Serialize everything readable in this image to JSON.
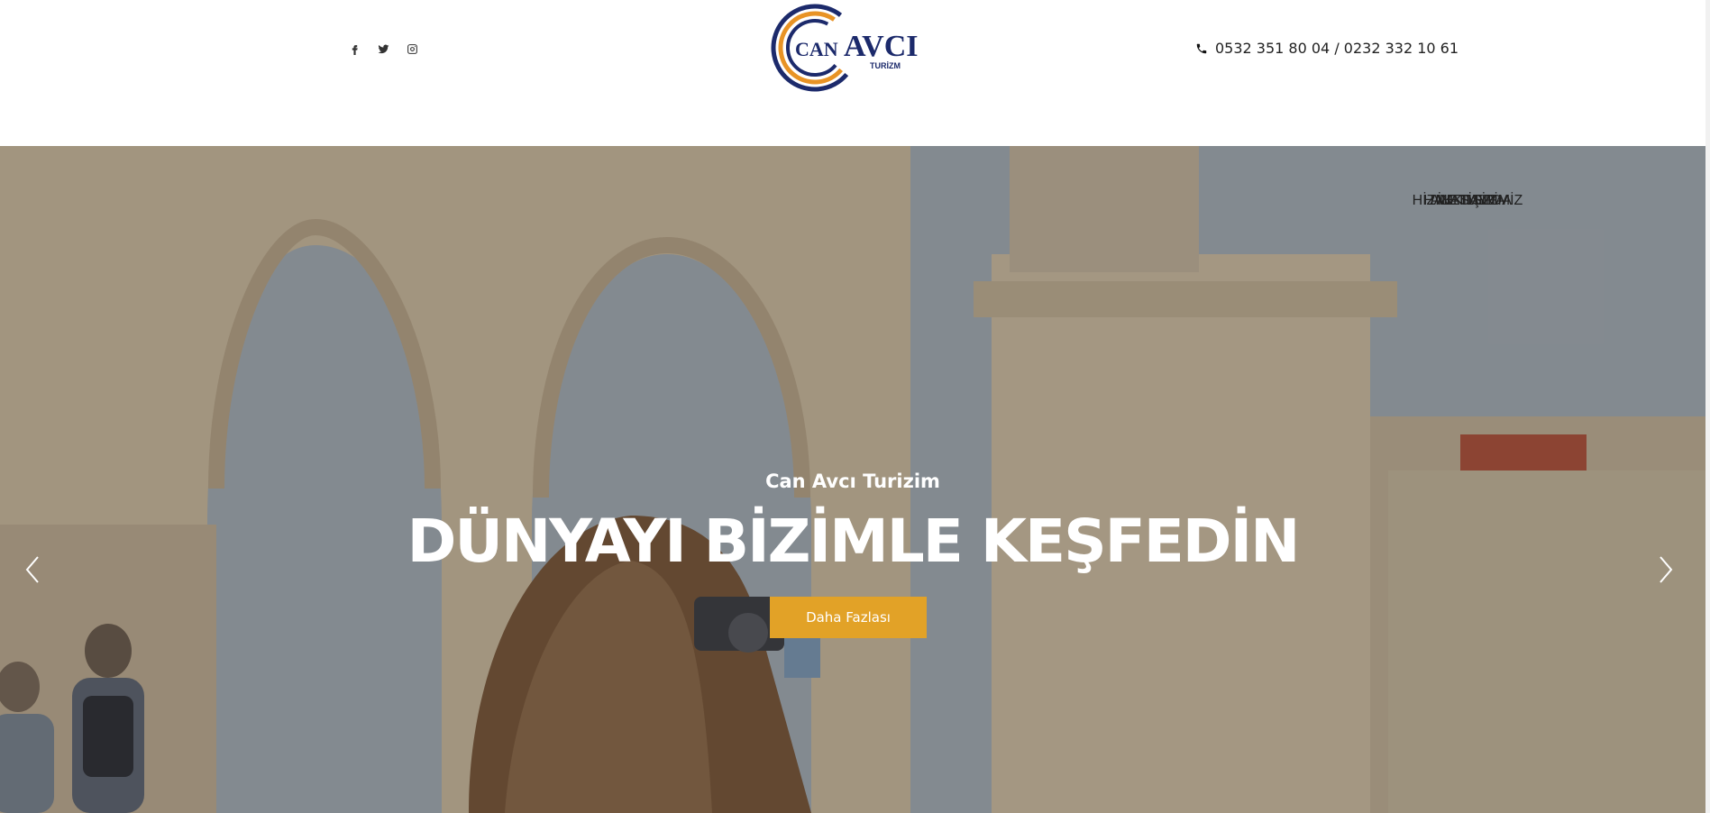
{
  "header": {
    "social": [
      {
        "name": "facebook-icon"
      },
      {
        "name": "twitter-icon"
      },
      {
        "name": "instagram-icon"
      }
    ],
    "logo": {
      "text_can": "CAN",
      "text_avci": "AVCI",
      "text_turizm": "TURİZM",
      "colors": {
        "navy": "#1c2a6b",
        "orange": "#e89325"
      }
    },
    "phone": "0532 351 80 04 / 0232 332 10 61"
  },
  "nav": {
    "items": [
      {
        "label": "ANASAYFA",
        "active": true
      },
      {
        "label": "HİZMETLERİMİZ",
        "active": false
      },
      {
        "label": "HAKKIMIZDA",
        "active": false
      },
      {
        "label": "İLETİŞİM",
        "active": false
      }
    ],
    "active_color": "#e8a020"
  },
  "hero": {
    "subtitle": "Can Avcı Turizim",
    "title": "DÜNYAYI BİZİMLE KEŞFEDİN",
    "button_label": "Daha Fazlası",
    "button_color": "#e2a227",
    "prev_icon": "chevron-left-icon",
    "next_icon": "chevron-right-icon"
  }
}
